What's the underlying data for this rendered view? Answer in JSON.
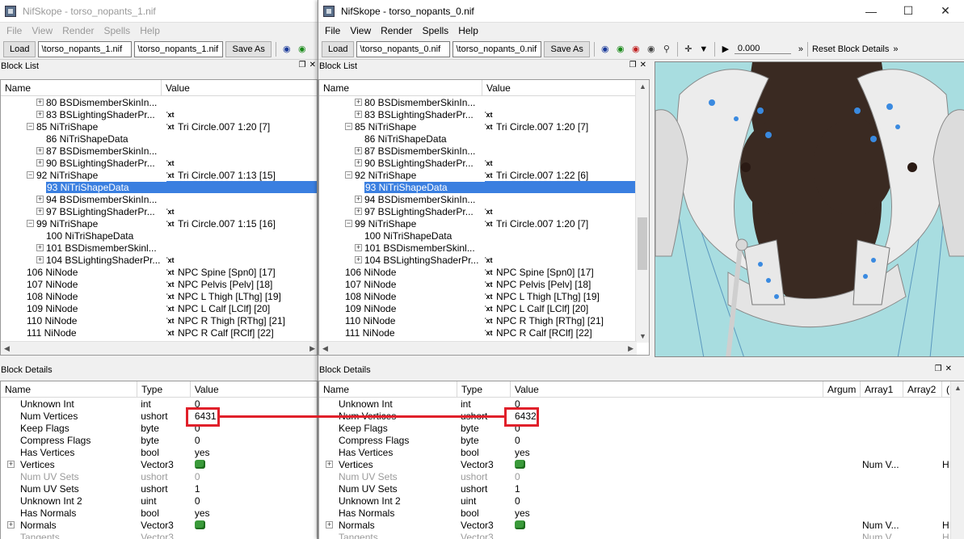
{
  "left": {
    "title": "NifSkope - torso_nopants_1.nif",
    "menu": [
      "File",
      "View",
      "Render",
      "Spells",
      "Help"
    ],
    "toolbar": {
      "load": "Load",
      "path1": "\\torso_nopants_1.nif",
      "path2": "\\torso_nopants_1.nif",
      "save": "Save As"
    },
    "block_list_title": "Block List",
    "bl_headers": [
      "Name",
      "Value"
    ],
    "block_details_title": "Block Details",
    "bd_headers": [
      "Name",
      "Type",
      "Value"
    ]
  },
  "right": {
    "title": "NifSkope - torso_nopants_0.nif",
    "menu": [
      "File",
      "View",
      "Render",
      "Spells",
      "Help"
    ],
    "toolbar": {
      "load": "Load",
      "path1": "\\torso_nopants_0.nif",
      "path2": "\\torso_nopants_0.nif",
      "save": "Save As",
      "time": "0.000",
      "reset": "Reset Block Details"
    },
    "block_list_title": "Block List",
    "bl_headers": [
      "Name",
      "Value"
    ],
    "block_details_title": "Block Details",
    "bd_headers": [
      "Name",
      "Type",
      "Value",
      "Argum",
      "Array1",
      "Array2",
      "("
    ]
  },
  "tree_left": [
    {
      "i": 2,
      "e": "+",
      "n": "80 BSDismemberSkinIn...",
      "t": "",
      "v": ""
    },
    {
      "i": 2,
      "e": "+",
      "n": "83 BSLightingShaderPr...",
      "t": "Txt",
      "v": ""
    },
    {
      "i": 1,
      "e": "-",
      "n": "85 NiTriShape",
      "t": "Txt",
      "v": "Tri Circle.007 1:20 [7]"
    },
    {
      "i": 2,
      "e": "",
      "n": "86 NiTriShapeData",
      "t": "",
      "v": ""
    },
    {
      "i": 2,
      "e": "+",
      "n": "87 BSDismemberSkinIn...",
      "t": "",
      "v": ""
    },
    {
      "i": 2,
      "e": "+",
      "n": "90 BSLightingShaderPr...",
      "t": "Txt",
      "v": ""
    },
    {
      "i": 1,
      "e": "-",
      "n": "92 NiTriShape",
      "t": "Txt",
      "v": "Tri Circle.007 1:13 [15]"
    },
    {
      "i": 2,
      "e": "",
      "n": "93 NiTriShapeData",
      "t": "",
      "v": "",
      "sel": true
    },
    {
      "i": 2,
      "e": "+",
      "n": "94 BSDismemberSkinIn...",
      "t": "",
      "v": ""
    },
    {
      "i": 2,
      "e": "+",
      "n": "97 BSLightingShaderPr...",
      "t": "Txt",
      "v": ""
    },
    {
      "i": 1,
      "e": "-",
      "n": "99 NiTriShape",
      "t": "Txt",
      "v": "Tri Circle.007 1:15 [16]"
    },
    {
      "i": 2,
      "e": "",
      "n": "100 NiTriShapeData",
      "t": "",
      "v": ""
    },
    {
      "i": 2,
      "e": "+",
      "n": "101 BSDismemberSkinl...",
      "t": "",
      "v": ""
    },
    {
      "i": 2,
      "e": "+",
      "n": "104 BSLightingShaderPr...",
      "t": "Txt",
      "v": ""
    },
    {
      "i": 0,
      "e": "",
      "n": "106 NiNode",
      "t": "Txt",
      "v": "NPC Spine [Spn0] [17]"
    },
    {
      "i": 0,
      "e": "",
      "n": "107 NiNode",
      "t": "Txt",
      "v": "NPC Pelvis [Pelv] [18]"
    },
    {
      "i": 0,
      "e": "",
      "n": "108 NiNode",
      "t": "Txt",
      "v": "NPC L Thigh [LThg] [19]"
    },
    {
      "i": 0,
      "e": "",
      "n": "109 NiNode",
      "t": "Txt",
      "v": "NPC L Calf [LClf] [20]"
    },
    {
      "i": 0,
      "e": "",
      "n": "110 NiNode",
      "t": "Txt",
      "v": "NPC R Thigh [RThg] [21]"
    },
    {
      "i": 0,
      "e": "",
      "n": "111 NiNode",
      "t": "Txt",
      "v": "NPC R Calf [RClf] [22]"
    }
  ],
  "tree_right": [
    {
      "i": 2,
      "e": "+",
      "n": "80 BSDismemberSkinIn...",
      "t": "",
      "v": ""
    },
    {
      "i": 2,
      "e": "+",
      "n": "83 BSLightingShaderPr...",
      "t": "Txt",
      "v": ""
    },
    {
      "i": 1,
      "e": "-",
      "n": "85 NiTriShape",
      "t": "Txt",
      "v": "Tri Circle.007 1:20 [7]"
    },
    {
      "i": 2,
      "e": "",
      "n": "86 NiTriShapeData",
      "t": "",
      "v": ""
    },
    {
      "i": 2,
      "e": "+",
      "n": "87 BSDismemberSkinIn...",
      "t": "",
      "v": ""
    },
    {
      "i": 2,
      "e": "+",
      "n": "90 BSLightingShaderPr...",
      "t": "Txt",
      "v": ""
    },
    {
      "i": 1,
      "e": "-",
      "n": "92 NiTriShape",
      "t": "Txt",
      "v": "Tri Circle.007 1:22 [6]"
    },
    {
      "i": 2,
      "e": "",
      "n": "93 NiTriShapeData",
      "t": "",
      "v": "",
      "sel": true
    },
    {
      "i": 2,
      "e": "+",
      "n": "94 BSDismemberSkinIn...",
      "t": "",
      "v": ""
    },
    {
      "i": 2,
      "e": "+",
      "n": "97 BSLightingShaderPr...",
      "t": "Txt",
      "v": ""
    },
    {
      "i": 1,
      "e": "-",
      "n": "99 NiTriShape",
      "t": "Txt",
      "v": "Tri Circle.007 1:20 [7]"
    },
    {
      "i": 2,
      "e": "",
      "n": "100 NiTriShapeData",
      "t": "",
      "v": ""
    },
    {
      "i": 2,
      "e": "+",
      "n": "101 BSDismemberSkinl...",
      "t": "",
      "v": ""
    },
    {
      "i": 2,
      "e": "+",
      "n": "104 BSLightingShaderPr...",
      "t": "Txt",
      "v": ""
    },
    {
      "i": 0,
      "e": "",
      "n": "106 NiNode",
      "t": "Txt",
      "v": "NPC Spine [Spn0] [17]"
    },
    {
      "i": 0,
      "e": "",
      "n": "107 NiNode",
      "t": "Txt",
      "v": "NPC Pelvis [Pelv] [18]"
    },
    {
      "i": 0,
      "e": "",
      "n": "108 NiNode",
      "t": "Txt",
      "v": "NPC L Thigh [LThg] [19]"
    },
    {
      "i": 0,
      "e": "",
      "n": "109 NiNode",
      "t": "Txt",
      "v": "NPC L Calf [LClf] [20]"
    },
    {
      "i": 0,
      "e": "",
      "n": "110 NiNode",
      "t": "Txt",
      "v": "NPC R Thigh [RThg] [21]"
    },
    {
      "i": 0,
      "e": "",
      "n": "111 NiNode",
      "t": "Txt",
      "v": "NPC R Calf [RClf] [22]"
    }
  ],
  "details_left": [
    {
      "e": "",
      "n": "Unknown Int",
      "ty": "int",
      "v": "0",
      "g": false
    },
    {
      "e": "",
      "n": "Num Vertices",
      "ty": "ushort",
      "v": "6431",
      "g": false
    },
    {
      "e": "",
      "n": "Keep Flags",
      "ty": "byte",
      "v": "0",
      "g": false
    },
    {
      "e": "",
      "n": "Compress Flags",
      "ty": "byte",
      "v": "0",
      "g": false
    },
    {
      "e": "",
      "n": "Has Vertices",
      "ty": "bool",
      "v": "yes",
      "g": false
    },
    {
      "e": "+",
      "n": "Vertices",
      "ty": "Vector3",
      "v": "",
      "c": true,
      "g": false
    },
    {
      "e": "",
      "n": "Num UV Sets",
      "ty": "ushort",
      "v": "0",
      "g": true
    },
    {
      "e": "",
      "n": "Num UV Sets",
      "ty": "ushort",
      "v": "1",
      "g": false
    },
    {
      "e": "",
      "n": "Unknown Int 2",
      "ty": "uint",
      "v": "0",
      "g": false
    },
    {
      "e": "",
      "n": "Has Normals",
      "ty": "bool",
      "v": "yes",
      "g": false
    },
    {
      "e": "+",
      "n": "Normals",
      "ty": "Vector3",
      "v": "",
      "c": true,
      "g": false
    },
    {
      "e": "",
      "n": "Tangents",
      "ty": "Vector3",
      "v": "",
      "g": true
    }
  ],
  "details_right": [
    {
      "e": "",
      "n": "Unknown Int",
      "ty": "int",
      "v": "0",
      "a1": "",
      "x": "",
      "g": false
    },
    {
      "e": "",
      "n": "Num Vertices",
      "ty": "ushort",
      "v": "6432",
      "a1": "",
      "x": "",
      "g": false
    },
    {
      "e": "",
      "n": "Keep Flags",
      "ty": "byte",
      "v": "0",
      "a1": "",
      "x": "",
      "g": false
    },
    {
      "e": "",
      "n": "Compress Flags",
      "ty": "byte",
      "v": "0",
      "a1": "",
      "x": "",
      "g": false
    },
    {
      "e": "",
      "n": "Has Vertices",
      "ty": "bool",
      "v": "yes",
      "a1": "",
      "x": "",
      "g": false
    },
    {
      "e": "+",
      "n": "Vertices",
      "ty": "Vector3",
      "v": "",
      "c": true,
      "a1": "Num V...",
      "x": "H",
      "g": false
    },
    {
      "e": "",
      "n": "Num UV Sets",
      "ty": "ushort",
      "v": "0",
      "a1": "",
      "x": "",
      "g": true
    },
    {
      "e": "",
      "n": "Num UV Sets",
      "ty": "ushort",
      "v": "1",
      "a1": "",
      "x": "",
      "g": false
    },
    {
      "e": "",
      "n": "Unknown Int 2",
      "ty": "uint",
      "v": "0",
      "a1": "",
      "x": "",
      "g": false
    },
    {
      "e": "",
      "n": "Has Normals",
      "ty": "bool",
      "v": "yes",
      "a1": "",
      "x": "",
      "g": false
    },
    {
      "e": "+",
      "n": "Normals",
      "ty": "Vector3",
      "v": "",
      "c": true,
      "a1": "Num V...",
      "x": "H",
      "g": false
    },
    {
      "e": "",
      "n": "Tangents",
      "ty": "Vector3",
      "v": "",
      "a1": "Num V...",
      "x": "H",
      "g": true
    }
  ],
  "colors": {
    "selection": "#3a7fe0",
    "highlight": "#e0202a",
    "viewport_bg": "#a8dde0",
    "skin": "#3a2a22"
  }
}
